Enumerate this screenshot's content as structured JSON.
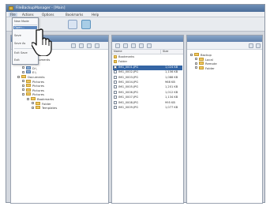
{
  "window": {
    "title": "FileBackupManager - [Main]"
  },
  "menubar": {
    "items": [
      "File",
      "Actions",
      "Options",
      "Bookmarks",
      "Help"
    ]
  },
  "dropdown": {
    "items": [
      "New Mode",
      "Open...",
      "Save",
      "Save As",
      "Exit Save",
      "Exit"
    ],
    "active_index": 1
  },
  "left_tree": [
    "Computer",
    "My Documents",
    "C:\\",
    "D:\\",
    "E:\\",
    "Documents",
    "Pictures",
    "Pictures",
    "Pictures",
    "Pictures",
    "Bookmarks",
    "Folder",
    "Templates"
  ],
  "middle": {
    "columns": [
      "Name",
      "Size"
    ],
    "rows": [
      {
        "name": "Bookmarks",
        "size": "",
        "kind": "folder"
      },
      {
        "name": "Folder",
        "size": "",
        "kind": "folder"
      },
      {
        "name": "IMG_0001.JPG",
        "size": "1,024 KB",
        "kind": "file",
        "selected": true
      },
      {
        "name": "IMG_0002.JPG",
        "size": "1,156 KB",
        "kind": "file"
      },
      {
        "name": "IMG_0003.JPG",
        "size": "1,088 KB",
        "kind": "file"
      },
      {
        "name": "IMG_0004.JPG",
        "size": "968 KB",
        "kind": "file"
      },
      {
        "name": "IMG_0005.JPG",
        "size": "1,201 KB",
        "kind": "file"
      },
      {
        "name": "IMG_0006.JPG",
        "size": "1,012 KB",
        "kind": "file"
      },
      {
        "name": "IMG_0007.JPG",
        "size": "1,134 KB",
        "kind": "file"
      },
      {
        "name": "IMG_0008.JPG",
        "size": "995 KB",
        "kind": "file"
      },
      {
        "name": "IMG_0009.JPG",
        "size": "1,077 KB",
        "kind": "file"
      }
    ]
  },
  "right_tree": [
    "Backup",
    "Local",
    "Remote",
    "Folder"
  ],
  "colors": {
    "selection": "#3465a4",
    "titlebar": "#4b6d99",
    "folder": "#f0c760"
  }
}
